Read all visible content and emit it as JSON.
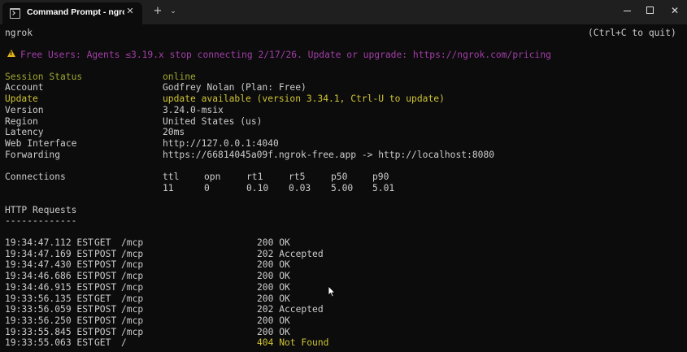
{
  "window": {
    "tab_title": "Command Prompt - ngrok  ht",
    "new_tab": "+",
    "tab_dropdown": "⌄",
    "close": "✕"
  },
  "ngrok": {
    "title": "ngrok",
    "quit_hint": "(Ctrl+C to quit)",
    "warning": "Free Users: Agents ≤3.19.x stop connecting 2/17/26. Update or upgrade: https://ngrok.com/pricing",
    "status": {
      "session_status_label": "Session Status",
      "session_status_value": "online",
      "account_label": "Account",
      "account_value": "Godfrey Nolan (Plan: Free)",
      "update_label": "Update",
      "update_value": "update available (version 3.34.1, Ctrl-U to update)",
      "version_label": "Version",
      "version_value": "3.24.0-msix",
      "region_label": "Region",
      "region_value": "United States (us)",
      "latency_label": "Latency",
      "latency_value": "20ms",
      "web_interface_label": "Web Interface",
      "web_interface_value": "http://127.0.0.1:4040",
      "forwarding_label": "Forwarding",
      "forwarding_value": "https://66814045a09f.ngrok-free.app -> http://localhost:8080"
    },
    "connections": {
      "label": "Connections",
      "headers": [
        "ttl",
        "opn",
        "rt1",
        "rt5",
        "p50",
        "p90"
      ],
      "values": [
        "11",
        "0",
        "0.10",
        "0.03",
        "5.00",
        "5.01"
      ]
    },
    "http_requests": {
      "label": "HTTP Requests",
      "underline": "-------------",
      "rows": [
        {
          "time": "19:34:47.112 EST",
          "method": "GET ",
          "path": "/mcp",
          "status": "200 OK",
          "color": "#cccccc"
        },
        {
          "time": "19:34:47.169 EST",
          "method": "POST",
          "path": "/mcp",
          "status": "202 Accepted",
          "color": "#cccccc"
        },
        {
          "time": "19:34:47.430 EST",
          "method": "POST",
          "path": "/mcp",
          "status": "200 OK",
          "color": "#cccccc"
        },
        {
          "time": "19:34:46.686 EST",
          "method": "POST",
          "path": "/mcp",
          "status": "200 OK",
          "color": "#cccccc"
        },
        {
          "time": "19:34:46.915 EST",
          "method": "POST",
          "path": "/mcp",
          "status": "200 OK",
          "color": "#cccccc"
        },
        {
          "time": "19:33:56.135 EST",
          "method": "GET ",
          "path": "/mcp",
          "status": "200 OK",
          "color": "#cccccc"
        },
        {
          "time": "19:33:56.059 EST",
          "method": "POST",
          "path": "/mcp",
          "status": "202 Accepted",
          "color": "#cccccc"
        },
        {
          "time": "19:33:56.250 EST",
          "method": "POST",
          "path": "/mcp",
          "status": "200 OK",
          "color": "#cccccc"
        },
        {
          "time": "19:33:55.845 EST",
          "method": "POST",
          "path": "/mcp",
          "status": "200 OK",
          "color": "#cccccc"
        },
        {
          "time": "19:33:55.063 EST",
          "method": "GET ",
          "path": "/",
          "status": "404 Not Found",
          "color": "#cfc434"
        }
      ]
    }
  },
  "colors": {
    "background": "#0c0c0c",
    "text": "#cccccc",
    "green": "#9fa62f",
    "warning_purple": "#a23ea8",
    "not_found_yellow": "#cfc434"
  }
}
